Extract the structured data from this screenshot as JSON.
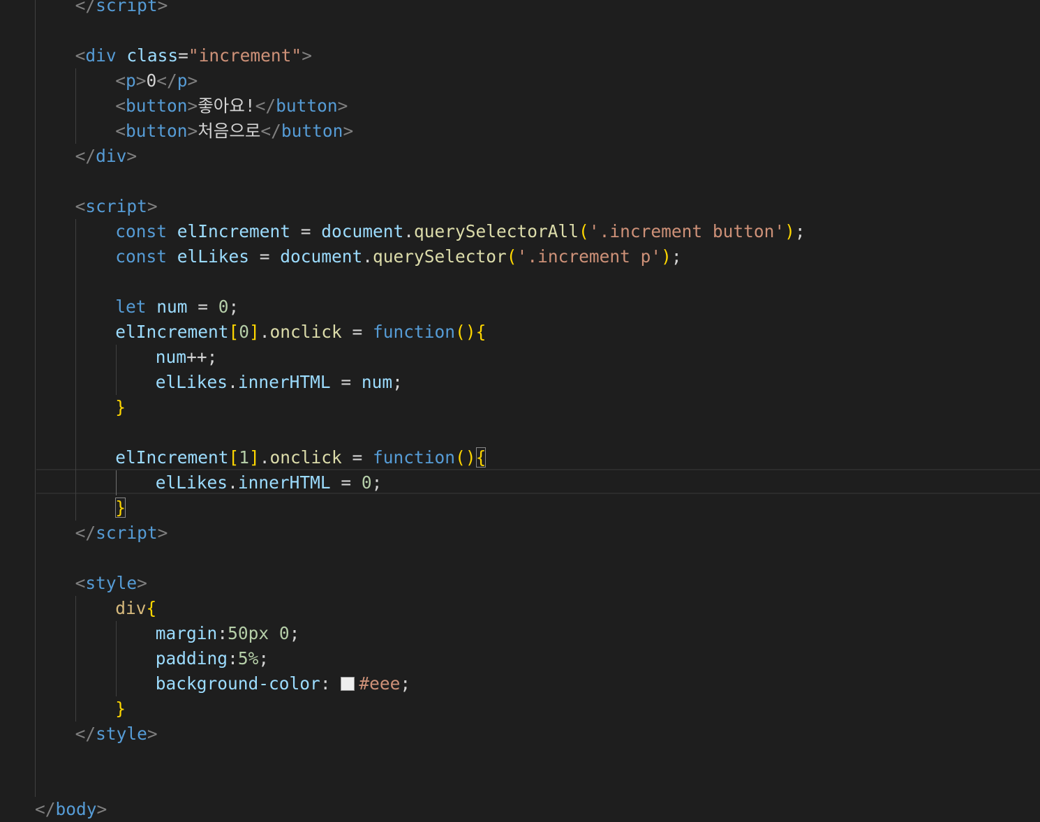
{
  "editor": {
    "lines": [
      {
        "indent": 2,
        "tokens": [
          [
            "punct",
            "</"
          ],
          [
            "tag",
            "script"
          ],
          [
            "punct",
            ">"
          ]
        ]
      },
      {
        "indent": 0,
        "tokens": []
      },
      {
        "indent": 2,
        "tokens": [
          [
            "punct",
            "<"
          ],
          [
            "tag",
            "div"
          ],
          [
            "text",
            " "
          ],
          [
            "attr",
            "class"
          ],
          [
            "text",
            "="
          ],
          [
            "str",
            "\"increment\""
          ],
          [
            "punct",
            ">"
          ]
        ]
      },
      {
        "indent": 4,
        "tokens": [
          [
            "punct",
            "<"
          ],
          [
            "tag",
            "p"
          ],
          [
            "punct",
            ">"
          ],
          [
            "text",
            "0"
          ],
          [
            "punct",
            "</"
          ],
          [
            "tag",
            "p"
          ],
          [
            "punct",
            ">"
          ]
        ]
      },
      {
        "indent": 4,
        "tokens": [
          [
            "punct",
            "<"
          ],
          [
            "tag",
            "button"
          ],
          [
            "punct",
            ">"
          ],
          [
            "text",
            "좋아요!"
          ],
          [
            "punct",
            "</"
          ],
          [
            "tag",
            "button"
          ],
          [
            "punct",
            ">"
          ]
        ]
      },
      {
        "indent": 4,
        "tokens": [
          [
            "punct",
            "<"
          ],
          [
            "tag",
            "button"
          ],
          [
            "punct",
            ">"
          ],
          [
            "text",
            "처음으로"
          ],
          [
            "punct",
            "</"
          ],
          [
            "tag",
            "button"
          ],
          [
            "punct",
            ">"
          ]
        ]
      },
      {
        "indent": 2,
        "tokens": [
          [
            "punct",
            "</"
          ],
          [
            "tag",
            "div"
          ],
          [
            "punct",
            ">"
          ]
        ]
      },
      {
        "indent": 0,
        "tokens": []
      },
      {
        "indent": 2,
        "tokens": [
          [
            "punct",
            "<"
          ],
          [
            "tag",
            "script"
          ],
          [
            "punct",
            ">"
          ]
        ]
      },
      {
        "indent": 4,
        "tokens": [
          [
            "kw",
            "const"
          ],
          [
            "text",
            " "
          ],
          [
            "var",
            "elIncrement"
          ],
          [
            "text",
            " = "
          ],
          [
            "var",
            "document"
          ],
          [
            "text",
            "."
          ],
          [
            "func",
            "querySelectorAll"
          ],
          [
            "brace1",
            "("
          ],
          [
            "str",
            "'.increment button'"
          ],
          [
            "brace1",
            ")"
          ],
          [
            "text",
            ";"
          ]
        ]
      },
      {
        "indent": 4,
        "tokens": [
          [
            "kw",
            "const"
          ],
          [
            "text",
            " "
          ],
          [
            "var",
            "elLikes"
          ],
          [
            "text",
            " = "
          ],
          [
            "var",
            "document"
          ],
          [
            "text",
            "."
          ],
          [
            "func",
            "querySelector"
          ],
          [
            "brace1",
            "("
          ],
          [
            "str",
            "'.increment p'"
          ],
          [
            "brace1",
            ")"
          ],
          [
            "text",
            ";"
          ]
        ]
      },
      {
        "indent": 0,
        "tokens": []
      },
      {
        "indent": 4,
        "tokens": [
          [
            "kw",
            "let"
          ],
          [
            "text",
            " "
          ],
          [
            "var",
            "num"
          ],
          [
            "text",
            " = "
          ],
          [
            "num",
            "0"
          ],
          [
            "text",
            ";"
          ]
        ]
      },
      {
        "indent": 4,
        "tokens": [
          [
            "var",
            "elIncrement"
          ],
          [
            "brace1",
            "["
          ],
          [
            "num",
            "0"
          ],
          [
            "brace1",
            "]"
          ],
          [
            "text",
            "."
          ],
          [
            "func",
            "onclick"
          ],
          [
            "text",
            " = "
          ],
          [
            "kw",
            "function"
          ],
          [
            "brace1",
            "()"
          ],
          [
            "brace1",
            "{"
          ]
        ]
      },
      {
        "indent": 6,
        "tokens": [
          [
            "var",
            "num"
          ],
          [
            "text",
            "++;"
          ]
        ]
      },
      {
        "indent": 6,
        "tokens": [
          [
            "var",
            "elLikes"
          ],
          [
            "text",
            "."
          ],
          [
            "var",
            "innerHTML"
          ],
          [
            "text",
            " = "
          ],
          [
            "var",
            "num"
          ],
          [
            "text",
            ";"
          ]
        ]
      },
      {
        "indent": 4,
        "tokens": [
          [
            "brace1",
            "}"
          ]
        ]
      },
      {
        "indent": 0,
        "tokens": []
      },
      {
        "indent": 4,
        "tokens": [
          [
            "var",
            "elIncrement"
          ],
          [
            "brace1",
            "["
          ],
          [
            "num",
            "1"
          ],
          [
            "brace1",
            "]"
          ],
          [
            "text",
            "."
          ],
          [
            "func",
            "onclick"
          ],
          [
            "text",
            " = "
          ],
          [
            "kw",
            "function"
          ],
          [
            "brace1",
            "()"
          ],
          [
            "brace1-match",
            "{"
          ]
        ]
      },
      {
        "indent": 6,
        "tokens": [
          [
            "var",
            "elLikes"
          ],
          [
            "text",
            "."
          ],
          [
            "var",
            "innerHTML"
          ],
          [
            "text",
            " = "
          ],
          [
            "num",
            "0"
          ],
          [
            "text",
            ";"
          ]
        ]
      },
      {
        "indent": 4,
        "tokens": [
          [
            "brace1-match",
            "}"
          ]
        ]
      },
      {
        "indent": 2,
        "tokens": [
          [
            "punct",
            "</"
          ],
          [
            "tag",
            "script"
          ],
          [
            "punct",
            ">"
          ]
        ]
      },
      {
        "indent": 0,
        "tokens": []
      },
      {
        "indent": 2,
        "tokens": [
          [
            "punct",
            "<"
          ],
          [
            "tag",
            "style"
          ],
          [
            "punct",
            ">"
          ]
        ]
      },
      {
        "indent": 4,
        "tokens": [
          [
            "sel",
            "div"
          ],
          [
            "brace1",
            "{"
          ]
        ]
      },
      {
        "indent": 6,
        "tokens": [
          [
            "prop",
            "margin"
          ],
          [
            "text",
            ":"
          ],
          [
            "num",
            "50px"
          ],
          [
            "text",
            " "
          ],
          [
            "num",
            "0"
          ],
          [
            "text",
            ";"
          ]
        ]
      },
      {
        "indent": 6,
        "tokens": [
          [
            "prop",
            "padding"
          ],
          [
            "text",
            ":"
          ],
          [
            "num",
            "5%"
          ],
          [
            "text",
            ";"
          ]
        ]
      },
      {
        "indent": 6,
        "tokens": [
          [
            "prop",
            "background-color"
          ],
          [
            "text",
            ": "
          ],
          [
            "swatch",
            "#eee"
          ],
          [
            "str",
            "#eee"
          ],
          [
            "text",
            ";"
          ]
        ]
      },
      {
        "indent": 4,
        "tokens": [
          [
            "brace1",
            "}"
          ]
        ]
      },
      {
        "indent": 2,
        "tokens": [
          [
            "punct",
            "</"
          ],
          [
            "tag",
            "style"
          ],
          [
            "punct",
            ">"
          ]
        ]
      },
      {
        "indent": 0,
        "tokens": []
      },
      {
        "indent": 0,
        "tokens": []
      },
      {
        "indent": 0,
        "tokens": [
          [
            "punct",
            "</"
          ],
          [
            "tag",
            "body"
          ],
          [
            "punct",
            ">"
          ]
        ]
      }
    ]
  }
}
